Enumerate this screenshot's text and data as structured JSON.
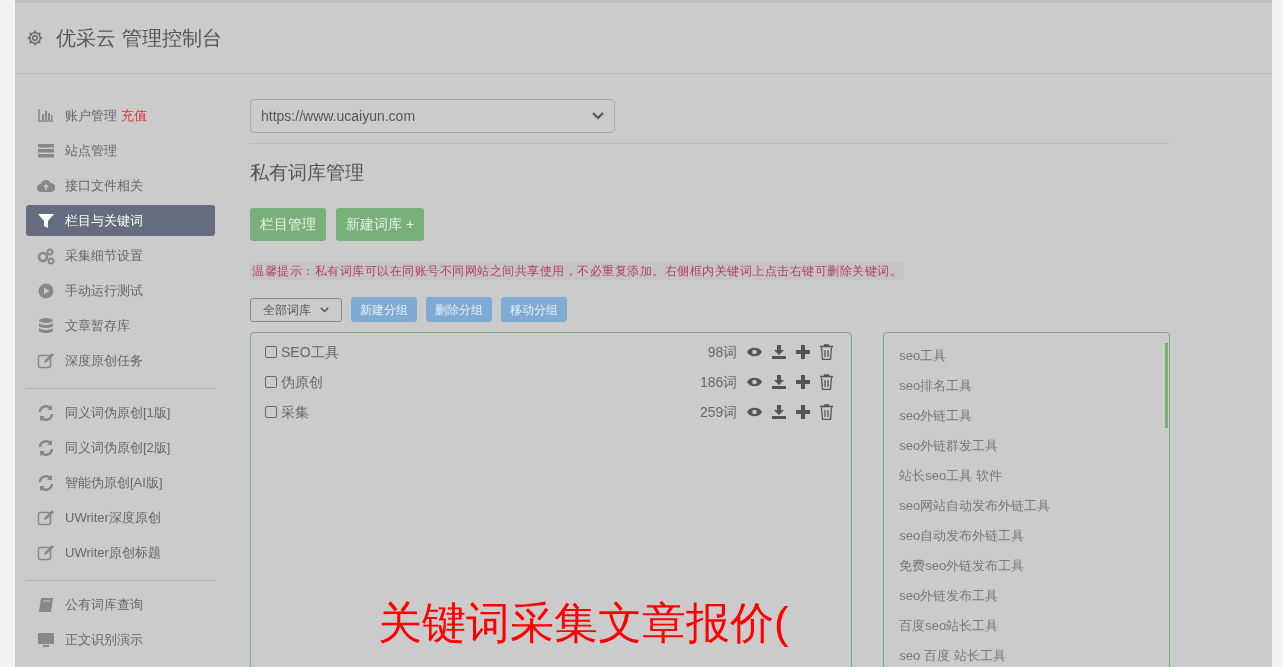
{
  "header": {
    "title": "优采云 管理控制台"
  },
  "sidebar": {
    "sections": [
      {
        "items": [
          {
            "label": "账户管理",
            "badge": "充值",
            "selected": false
          },
          {
            "label": "站点管理",
            "selected": false
          },
          {
            "label": "接口文件相关",
            "selected": false
          },
          {
            "label": "栏目与关键词",
            "selected": true
          },
          {
            "label": "采集细节设置",
            "selected": false
          },
          {
            "label": "手动运行测试",
            "selected": false
          },
          {
            "label": "文章暂存库",
            "selected": false
          },
          {
            "label": "深度原创任务",
            "selected": false
          }
        ]
      },
      {
        "items": [
          {
            "label": "同义词伪原创[1版]",
            "selected": false
          },
          {
            "label": "同义词伪原创[2版]",
            "selected": false
          },
          {
            "label": "智能伪原创[AI版]",
            "selected": false
          },
          {
            "label": "UWriter深度原创",
            "selected": false
          },
          {
            "label": "UWriter原创标题",
            "selected": false
          }
        ]
      },
      {
        "items": [
          {
            "label": "公有词库查询",
            "selected": false
          },
          {
            "label": "正文识别演示",
            "selected": false
          }
        ]
      }
    ]
  },
  "site_select": {
    "value": "https://www.ucaiyun.com"
  },
  "page_title": "私有词库管理",
  "action_buttons": [
    {
      "label": "栏目管理"
    },
    {
      "label": "新建词库 +"
    }
  ],
  "hint": "温馨提示：私有词库可以在同账号不同网站之间共享使用，不必重复添加。右侧框内关键词上点击右键可删除关键词。",
  "group_select": {
    "value": "全部词库"
  },
  "group_buttons": [
    {
      "label": "新建分组"
    },
    {
      "label": "删除分组"
    },
    {
      "label": "移动分组"
    }
  ],
  "libraries": [
    {
      "name": "SEO工具",
      "count": "98词",
      "checked": false
    },
    {
      "name": "伪原创",
      "count": "186词",
      "checked": false
    },
    {
      "name": "采集",
      "count": "259词",
      "checked": false
    }
  ],
  "keywords": [
    "seo工具",
    "seo排名工具",
    "seo外链工具",
    "seo外链群发工具",
    "站长seo工具 软件",
    "seo网站自动发布外链工具",
    "seo自动发布外链工具",
    "免费seo外链发布工具",
    "seo外链发布工具",
    "百度seo站长工具",
    "seo 百度 站长工具"
  ],
  "overlay_caption": "关键词采集文章报价("
}
